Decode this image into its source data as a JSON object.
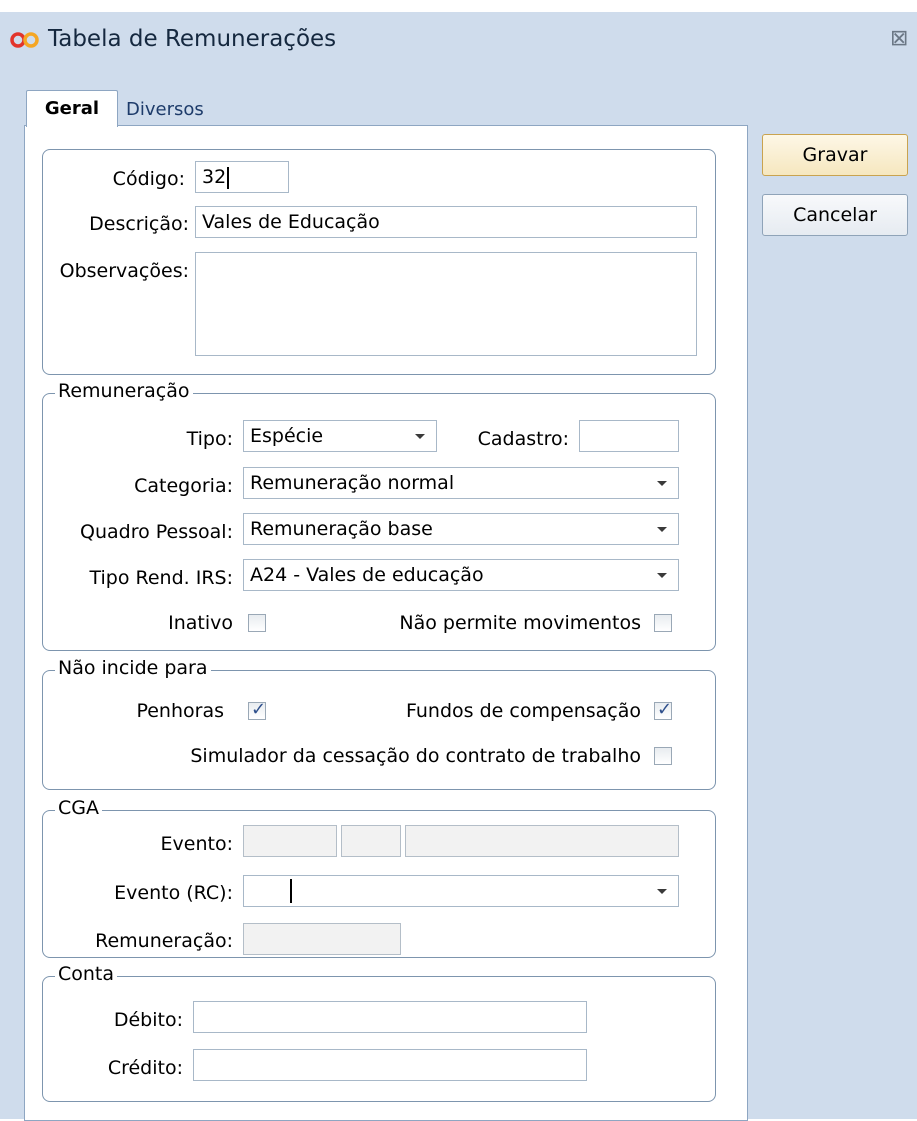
{
  "window": {
    "title": "Tabela de Remunerações",
    "close_icon": "close-icon"
  },
  "tabs": [
    {
      "label": "Geral",
      "active": true
    },
    {
      "label": "Diversos",
      "active": false
    }
  ],
  "buttons": {
    "save": "Gravar",
    "cancel": "Cancelar"
  },
  "general": {
    "codigo_label": "Código:",
    "codigo_value": "32",
    "descricao_label": "Descrição:",
    "descricao_value": "Vales de Educação",
    "observacoes_label": "Observações:",
    "observacoes_value": ""
  },
  "remuneracao": {
    "legend": "Remuneração",
    "tipo_label": "Tipo:",
    "tipo_value": "Espécie",
    "cadastro_label": "Cadastro:",
    "cadastro_value": "",
    "categoria_label": "Categoria:",
    "categoria_value": "Remuneração normal",
    "quadro_label": "Quadro Pessoal:",
    "quadro_value": "Remuneração base",
    "tipo_rend_label": "Tipo Rend. IRS:",
    "tipo_rend_value": "A24 - Vales de educação",
    "inativo_label": "Inativo",
    "inativo_checked": false,
    "nao_permite_label": "Não permite movimentos",
    "nao_permite_checked": false
  },
  "nao_incide": {
    "legend": "Não incide para",
    "penhoras_label": "Penhoras",
    "penhoras_checked": true,
    "fundos_label": "Fundos de compensação",
    "fundos_checked": true,
    "simulador_label": "Simulador da cessação do contrato de trabalho",
    "simulador_checked": false
  },
  "cga": {
    "legend": "CGA",
    "evento_label": "Evento:",
    "evento_rc_label": "Evento (RC):",
    "evento_rc_value": "",
    "remuneracao_label": "Remuneração:"
  },
  "conta": {
    "legend": "Conta",
    "debito_label": "Débito:",
    "debito_value": "",
    "credito_label": "Crédito:",
    "credito_value": ""
  },
  "colors": {
    "window_bg": "#cfdcec",
    "border": "#7d95ae",
    "checkmark": "#2e4f8c",
    "default_button": "#f6e7bf"
  }
}
